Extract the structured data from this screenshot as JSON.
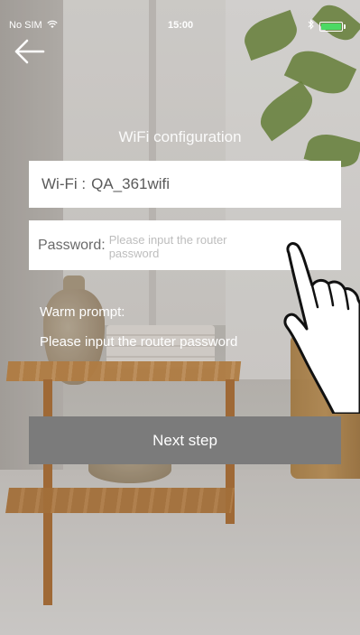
{
  "status_bar": {
    "carrier": "No SIM",
    "time": "15:00",
    "wifi_icon": "wifi-icon",
    "bluetooth_icon": "bluetooth-icon",
    "battery_icon": "battery-icon",
    "battery_color": "#4cd964"
  },
  "navigation": {
    "back_icon": "back-arrow-icon"
  },
  "page": {
    "title": "WiFi configuration"
  },
  "form": {
    "wifi_label": "Wi-Fi :",
    "wifi_ssid": "QA_361wifi",
    "password_label": "Password:",
    "password_value": "",
    "password_placeholder": "Please input the router password"
  },
  "prompt": {
    "title": "Warm prompt:",
    "text": "Please input the router password"
  },
  "actions": {
    "next_label": "Next step",
    "next_color": "#7b7b7b"
  },
  "overlay": {
    "hand_icon": "pointing-hand-icon"
  }
}
